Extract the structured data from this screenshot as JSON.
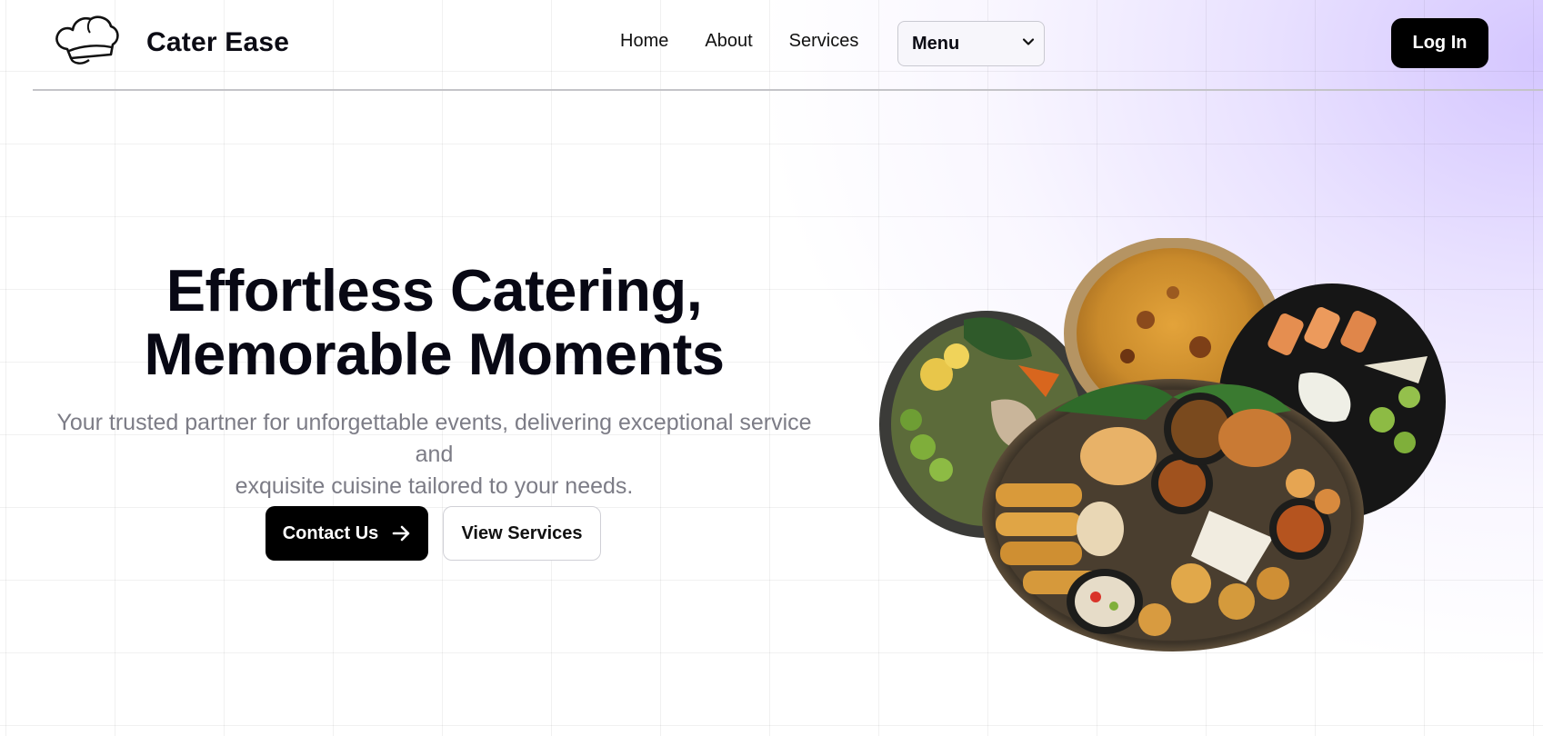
{
  "brand": {
    "name": "Cater Ease",
    "logo_icon": "chef-hat-icon"
  },
  "nav": {
    "items": [
      {
        "label": "Home"
      },
      {
        "label": "About"
      },
      {
        "label": "Services"
      }
    ],
    "menu_select": {
      "selected": "Menu",
      "icon": "chevron-down-icon"
    },
    "login_label": "Log In"
  },
  "hero": {
    "title_line1": "Effortless Catering,",
    "title_line2": "Memorable Moments",
    "subtitle_line1": "Your trusted partner for unforgettable events, delivering exceptional service and",
    "subtitle_line2": "exquisite cuisine tailored to your needs.",
    "contact_label": "Contact Us",
    "contact_icon": "arrow-right-icon",
    "services_label": "View Services"
  },
  "colors": {
    "primary_button": "#000000",
    "accent_gradient": "#d6c8ff",
    "subtitle_text": "#7c7c86"
  }
}
